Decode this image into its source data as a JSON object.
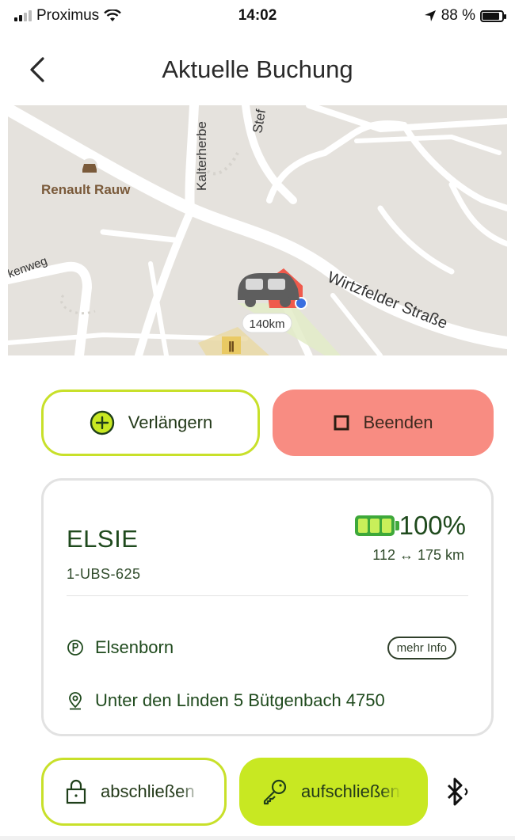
{
  "status_bar": {
    "carrier": "Proximus",
    "time": "14:02",
    "battery_percent": "88 %",
    "battery_level": 0.88
  },
  "header": {
    "title": "Aktuelle Buchung",
    "back_icon": "chevron-left-icon"
  },
  "map": {
    "labels": {
      "poi": "Renault Rauw",
      "street_main": "Wirtzfelder Straße",
      "street_vertical": "Kalterherbe",
      "street_top": "Stef",
      "street_left": "kenweg",
      "car_badge": "140km"
    },
    "colors": {
      "background": "#e5e2dd",
      "road": "#ffffff",
      "car": "#5e5e5e",
      "parking_marker": "#ef5a4c"
    }
  },
  "actions": {
    "extend_label": "Verlängern",
    "end_label": "Beenden"
  },
  "car": {
    "name": "ELSIE",
    "plate": "1-UBS-625",
    "charge": "100%",
    "charge_level": 1.0,
    "range": "112 ↔ 175 km",
    "location_name": "Elsenborn",
    "more_info_label": "mehr Info",
    "address": "Unter den Linden 5  Bütgenbach 4750"
  },
  "controls": {
    "lock_label": "abschließen",
    "unlock_label": "aufschließen",
    "bluetooth_icon": "bluetooth-icon"
  },
  "colors": {
    "accent": "#c8e822",
    "end_button": "#f88c82",
    "text_green": "#1f4a1d",
    "battery_green": "#3ea83a"
  }
}
